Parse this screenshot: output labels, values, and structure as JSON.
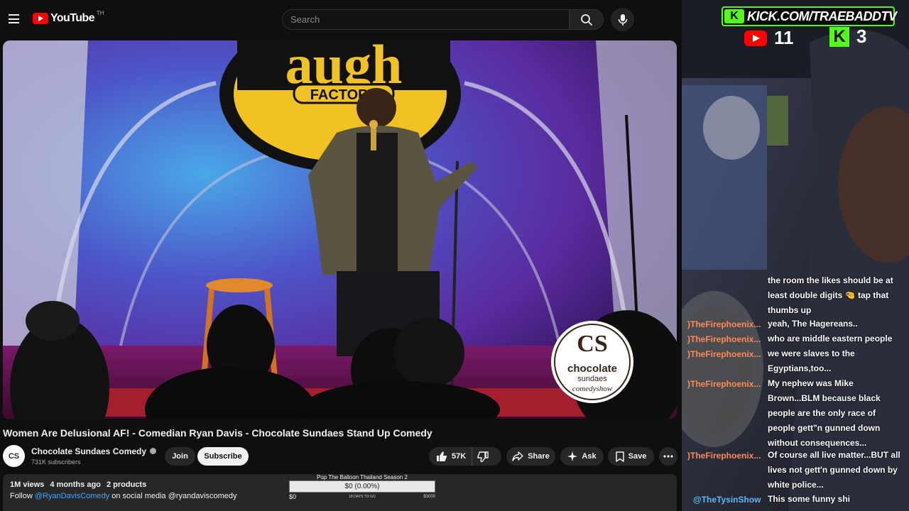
{
  "header": {
    "logo_text": "YouTube",
    "logo_tm": "TH",
    "search_placeholder": "Search"
  },
  "video": {
    "title": "Women Are Delusional AF! - Comedian Ryan Davis - Chocolate Sundaes Stand Up Comedy",
    "sign_text": "augh",
    "sign_factory": "FACTORY",
    "watermark_line1": "chocolate",
    "watermark_line2": "sundaes",
    "watermark_line3": "comedyshow"
  },
  "channel": {
    "avatar_text": "CS",
    "name": "Chocolate Sundaes Comedy",
    "subscribers": "731K subscribers",
    "join_label": "Join",
    "subscribe_label": "Subscribe"
  },
  "actions": {
    "likes": "57K",
    "share_label": "Share",
    "ask_label": "Ask",
    "save_label": "Save"
  },
  "description": {
    "views": "1M views",
    "age": "4 months ago",
    "products": "2 products",
    "follow_prefix": "Follow",
    "follow_link": "@RyanDavisComedy",
    "follow_suffix": "on social media @ryandaviscomedy"
  },
  "goal_widget": {
    "title": "Pop The Balloon Thailand Season 2",
    "bar_text": "$0 (0.00%)",
    "progress": 0,
    "min": "$0",
    "days_left": "18 DAYS TO GO",
    "max": "$3000"
  },
  "overlay": {
    "kick_url": "KICK.COM/TRAEBADDTV",
    "youtube_viewers": "11",
    "kick_viewers": "3"
  },
  "chat": [
    {
      "user": "",
      "lines": "the room the likes should be at least double digits 🤏 tap that thumbs up"
    },
    {
      "user": ")TheFirephoenix...",
      "lines": "yeah, The Hagereans.."
    },
    {
      "user": ")TheFirephoenix...",
      "lines": "who are middle eastern people"
    },
    {
      "user": ")TheFirephoenix...",
      "lines": "we were slaves to the Egyptians,too..."
    },
    {
      "user": ")TheFirephoenix...",
      "lines": "My nephew was Mike Brown...BLM because black people are the only race of people gett\"n gunned down without consequences..."
    },
    {
      "user": ")TheFirephoenix...",
      "lines": "Of course all live matter...BUT all lives not gett'n gunned down by white police..."
    },
    {
      "user": "@TheTysinShow",
      "lines": "This some funny shi"
    }
  ],
  "colors": {
    "accent_red": "#ff0000",
    "kick_green": "#53fc18",
    "link_blue": "#3ea6ff",
    "chat_user": "#ff8a55"
  }
}
